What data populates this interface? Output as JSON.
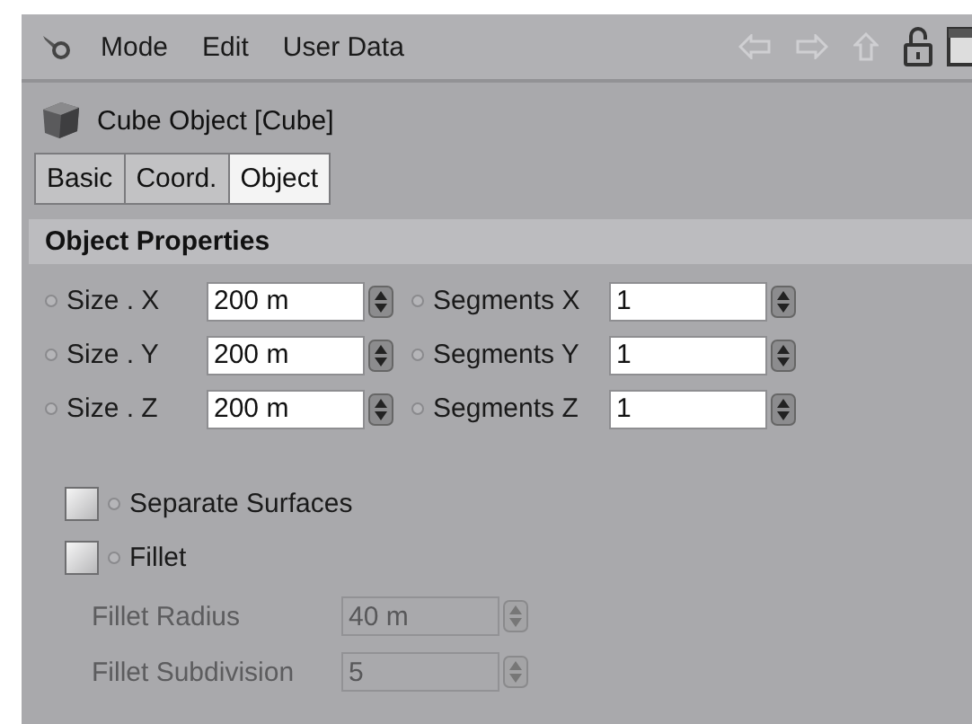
{
  "menu": {
    "items": [
      "Mode",
      "Edit",
      "User Data"
    ]
  },
  "object_title": "Cube Object [Cube]",
  "tabs": [
    {
      "label": "Basic",
      "selected": false
    },
    {
      "label": "Coord.",
      "selected": false
    },
    {
      "label": "Object",
      "selected": true
    }
  ],
  "section": {
    "title": "Object Properties"
  },
  "parameter_rows": [
    {
      "left": {
        "label": "Size . X",
        "value": "200 m"
      },
      "right": {
        "label": "Segments X",
        "value": "1"
      }
    },
    {
      "left": {
        "label": "Size . Y",
        "value": "200 m"
      },
      "right": {
        "label": "Segments Y",
        "value": "1"
      }
    },
    {
      "left": {
        "label": "Size . Z",
        "value": "200 m"
      },
      "right": {
        "label": "Segments Z",
        "value": "1"
      }
    }
  ],
  "options": [
    {
      "label": "Separate Surfaces",
      "checked": false
    },
    {
      "label": "Fillet",
      "checked": false
    }
  ],
  "fillet_fields": [
    {
      "label": "Fillet Radius",
      "value": "40 m",
      "disabled": true
    },
    {
      "label": "Fillet Subdivision",
      "value": "5",
      "disabled": true
    }
  ]
}
